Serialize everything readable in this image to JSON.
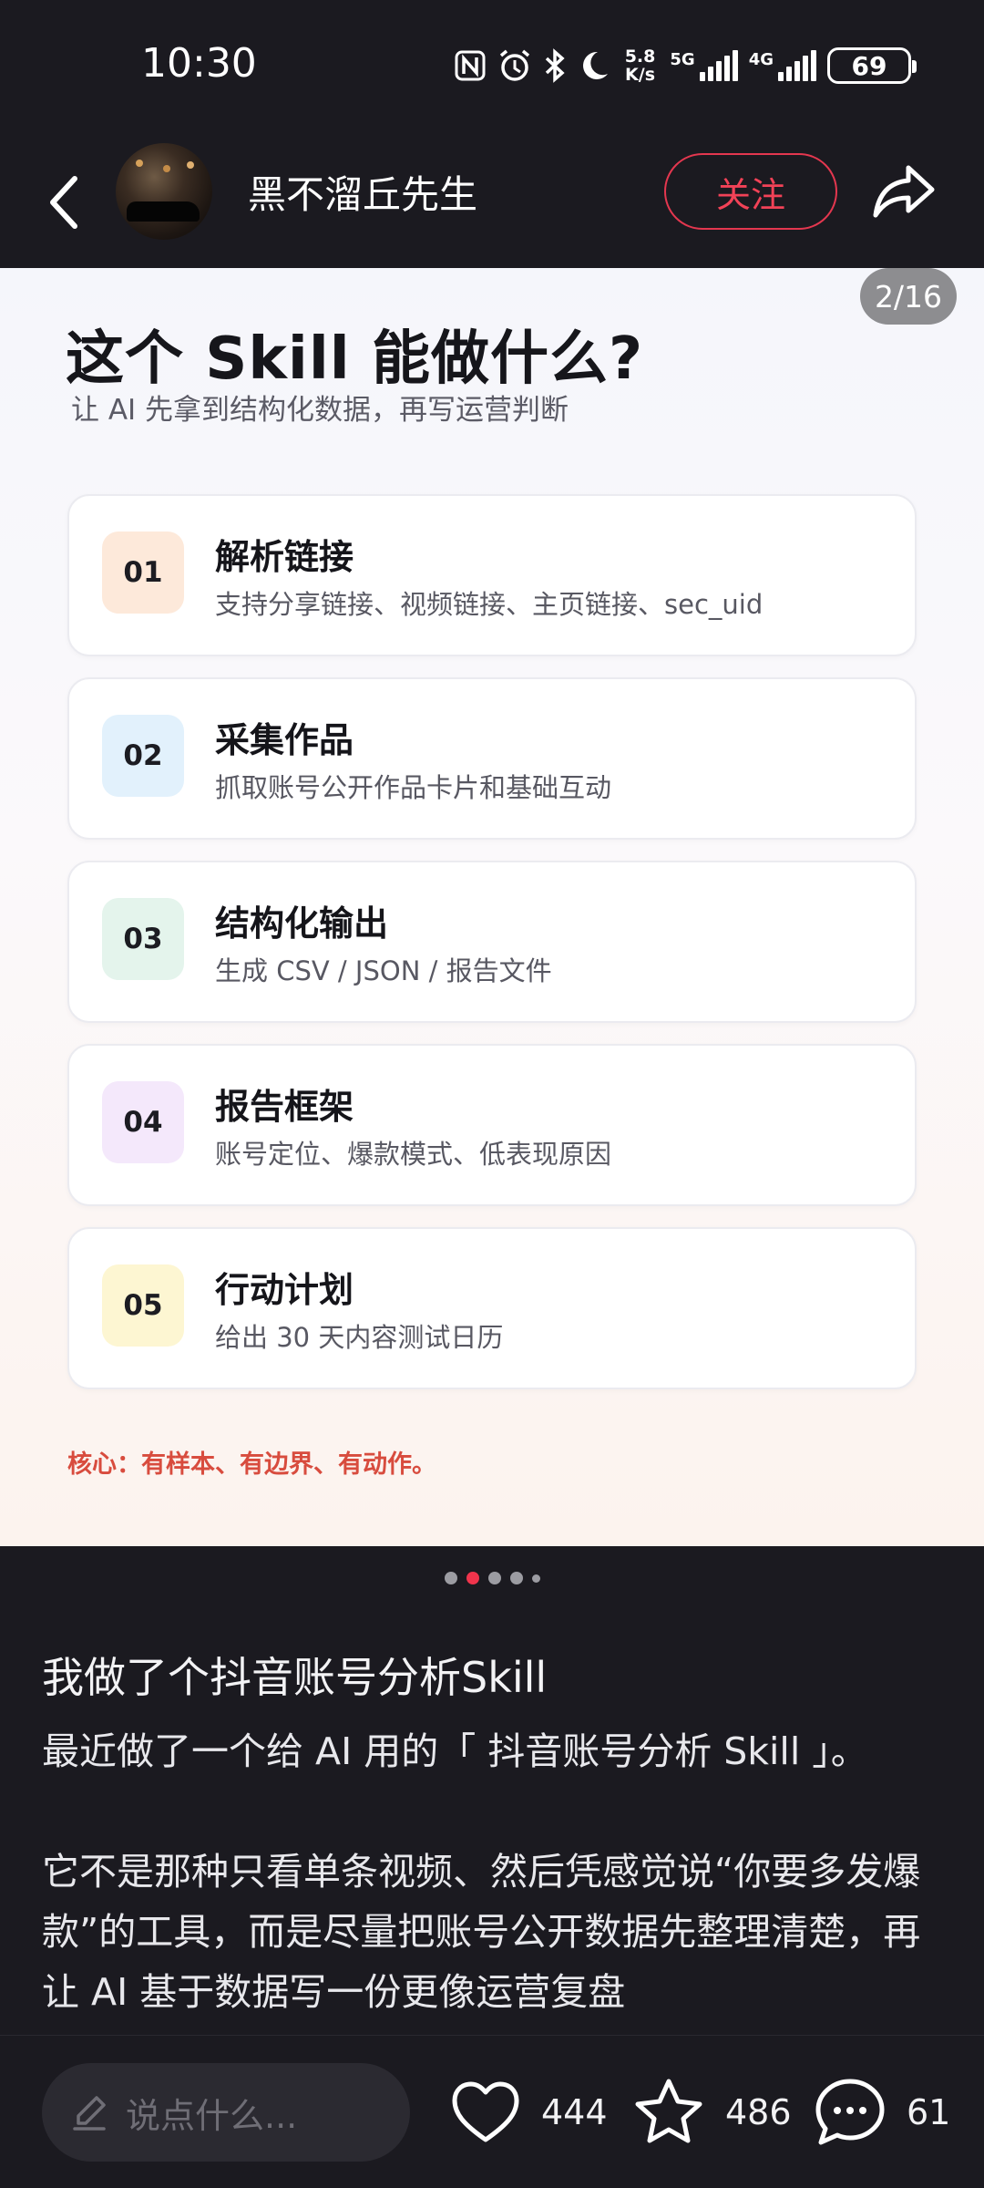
{
  "status_bar": {
    "time": "10:30",
    "net_speed_value": "5.8",
    "net_speed_unit": "K/s",
    "signal_1": "5G",
    "signal_2": "4G",
    "battery": "69",
    "icons": [
      "nfc-icon",
      "alarm-icon",
      "bluetooth-icon",
      "moon-icon",
      "signal-5g-icon",
      "signal-4g-icon",
      "battery-icon"
    ]
  },
  "header": {
    "author_name": "黑不溜丘先生",
    "follow_label": "关注"
  },
  "slide": {
    "page_indicator": "2/16",
    "title": "这个 Skill 能做什么?",
    "subtitle": "让 AI 先拿到结构化数据，再写运营判断",
    "cards": [
      {
        "num": "01",
        "title": "解析链接",
        "desc": "支持分享链接、视频链接、主页链接、sec_uid",
        "color": "#fde9da"
      },
      {
        "num": "02",
        "title": "采集作品",
        "desc": "抓取账号公开作品卡片和基础互动",
        "color": "#e2f1fc"
      },
      {
        "num": "03",
        "title": "结构化输出",
        "desc": "生成 CSV / JSON / 报告文件",
        "color": "#e4f4ec"
      },
      {
        "num": "04",
        "title": "报告框架",
        "desc": "账号定位、爆款模式、低表现原因",
        "color": "#f4e8fb"
      },
      {
        "num": "05",
        "title": "行动计划",
        "desc": "给出 30 天内容测试日历",
        "color": "#fdf6d2"
      }
    ],
    "core_line": "核心：有样本、有边界、有动作。"
  },
  "carousel": {
    "total_visible_dots": 5,
    "active_index": 1
  },
  "post": {
    "title": "我做了个抖音账号分析Skill",
    "paragraphs": [
      "最近做了一个给 AI 用的「 抖音账号分析 Skill 」。",
      "它不是那种只看单条视频、然后凭感觉说“你要多发爆款”的工具，而是尽量把账号公开数据先整理清楚，再让 AI 基于数据写一份更像运营复盘"
    ]
  },
  "bottom_bar": {
    "comment_placeholder": "说点什么...",
    "likes": "444",
    "favorites": "486",
    "comments": "61"
  }
}
